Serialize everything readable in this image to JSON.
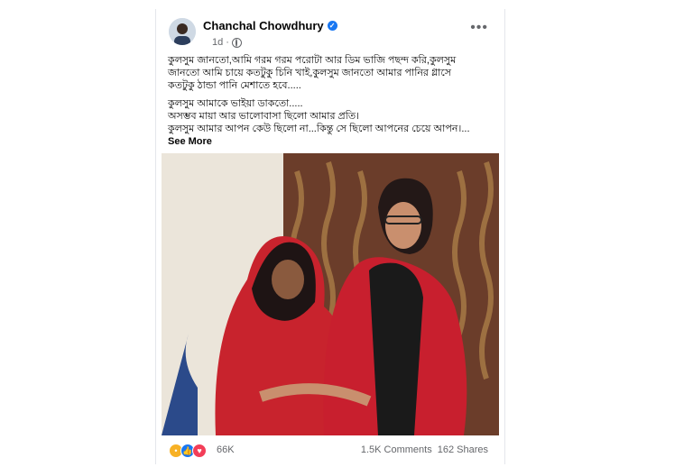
{
  "post": {
    "author": "Chanchal Chowdhury",
    "time": "1d",
    "text_lines": [
      "কুলসুম জানতো,আমি গরম গরম পরোটা আর ডিম ভাজি পছন্দ করি,কুলসুম জানতো আমি চায়ে কতটুকু চিনি খাই,কুলসুম জানতো আমার পানির গ্লাসে কতটুকু ঠান্ডা পানি মেশাতে হবে.....",
      "কুলসুম আমাকে ভাইয়া ডাকতো.....",
      "অসম্ভব মায়া আর ভালোবাসা ছিলো আমার প্রতি।",
      "কুলসুম আমার আপন কেউ ছিলো না...কিন্তু সে ছিলো আপনের চেয়ে আপন।..."
    ],
    "see_more": "See More"
  },
  "footer": {
    "reaction_count": "66K",
    "comments": "1.5K Comments",
    "shares": "162 Shares"
  },
  "icons": {
    "verified": "verified-badge-icon",
    "privacy": "globe-icon",
    "more": "more-options-icon"
  },
  "colors": {
    "accent": "#1877f2",
    "secondary_text": "#65676b"
  }
}
